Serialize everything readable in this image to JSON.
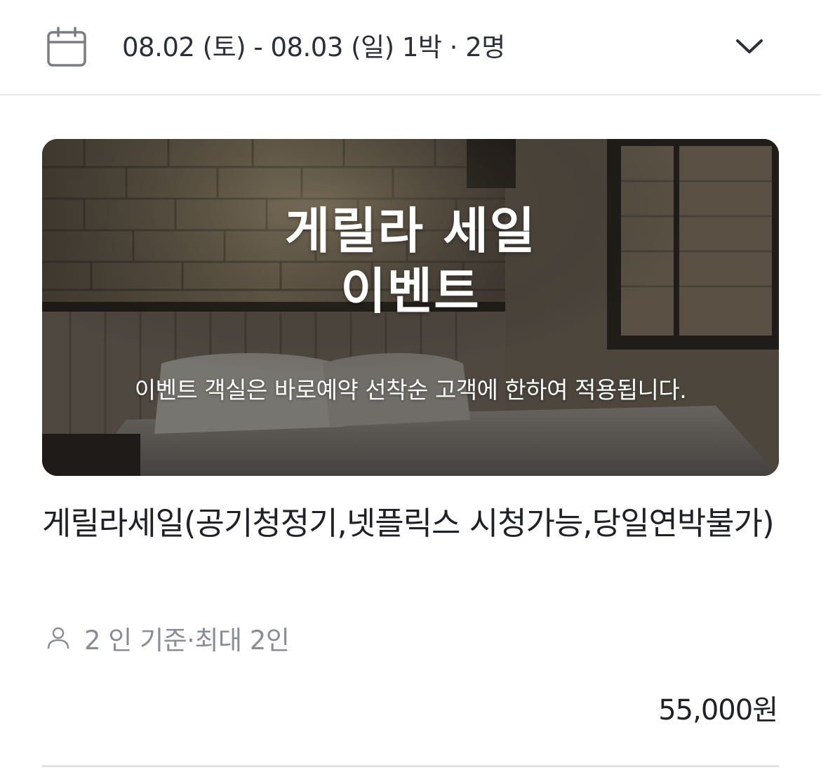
{
  "search_bar": {
    "date_range": "08.02 (토) - 08.03 (일) 1박 · 2명",
    "calendar_icon": "calendar-icon",
    "expand_icon": "chevron-down-icon"
  },
  "banner": {
    "title_line1": "게릴라 세일",
    "title_line2": "이벤트",
    "subtitle": "이벤트 객실은 바로예약 선착순 고객에 한하여 적용됩니다."
  },
  "room": {
    "name": "게릴라세일(공기청정기,넷플릭스 시청가능,당일연박불가)",
    "capacity": "2 인 기준·최대 2인",
    "capacity_icon": "person-icon",
    "price": "55,000원"
  },
  "colors": {
    "text_primary": "#1f2126",
    "text_secondary": "#8a8d93",
    "divider": "#e6e6e6",
    "icon": "#7a7d84"
  }
}
